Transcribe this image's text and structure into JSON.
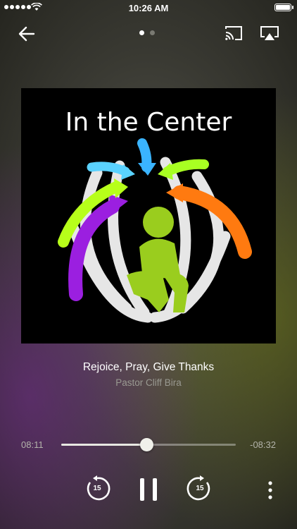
{
  "status_bar": {
    "time": "10:26 AM",
    "signal_bars": 5,
    "battery_level": 1.0
  },
  "header": {
    "back_icon": "arrow-left-icon",
    "page_indicator": {
      "count": 2,
      "active": 0
    },
    "cast_icon": "cast-icon",
    "airplay_icon": "airplay-icon"
  },
  "artwork": {
    "description_icon": "podcast-artwork",
    "logo_text": "In the Center"
  },
  "track": {
    "title": "Rejoice, Pray, Give Thanks",
    "artist": "Pastor Cliff Bira"
  },
  "progress": {
    "elapsed": "08:11",
    "remaining": "-08:32",
    "fraction": 0.49
  },
  "controls": {
    "skip_back_label": "15",
    "skip_forward_label": "15",
    "pause_icon": "pause-icon",
    "more_icon": "more-vertical-icon"
  },
  "colors": {
    "accent": "#ffffff",
    "secondary_text": "#9a9a92",
    "dot_active": "#ffffff",
    "dot_inactive": "#7a7a72"
  }
}
